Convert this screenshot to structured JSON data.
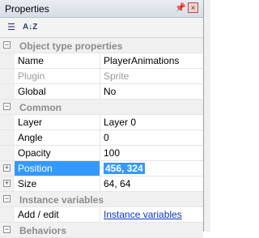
{
  "panel": {
    "title": "Properties"
  },
  "titlebar": {
    "pin_glyph": "📌",
    "close_glyph": "×"
  },
  "toolbar": {
    "categorized_glyph": "☰",
    "alphabetical_label": "A↓Z"
  },
  "sections": [
    {
      "title": "Object type properties",
      "rows": [
        {
          "name": "Name",
          "value": "PlayerAnimations"
        },
        {
          "name": "Plugin",
          "value": "Sprite",
          "disabled": true
        },
        {
          "name": "Global",
          "value": "No"
        }
      ]
    },
    {
      "title": "Common",
      "rows": [
        {
          "name": "Layer",
          "value": "Layer 0"
        },
        {
          "name": "Angle",
          "value": "0"
        },
        {
          "name": "Opacity",
          "value": "100"
        },
        {
          "name": "Position",
          "value": "456, 324",
          "expandable": true,
          "selected": true
        },
        {
          "name": "Size",
          "value": "64, 64",
          "expandable": true
        }
      ]
    },
    {
      "title": "Instance variables",
      "rows": [
        {
          "name": "Add / edit",
          "value": "Instance variables",
          "link": true
        }
      ]
    },
    {
      "title": "Behaviors",
      "rows": []
    }
  ],
  "icons": {
    "expander_minus": "−",
    "expander_plus": "+"
  }
}
